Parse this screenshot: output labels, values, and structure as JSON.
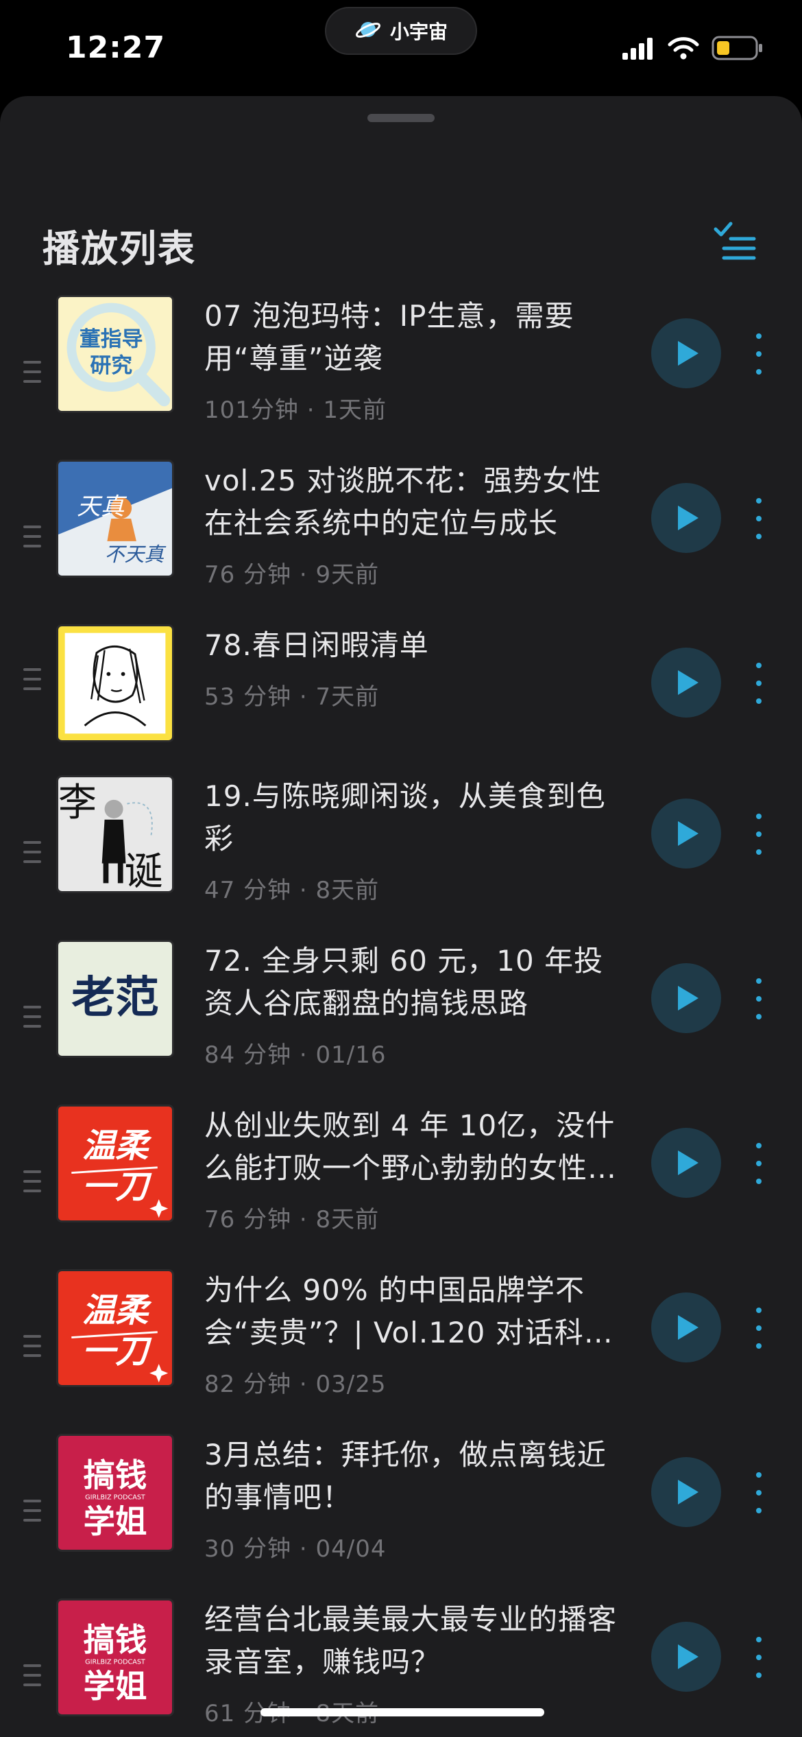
{
  "status_bar": {
    "time": "12:27",
    "island_label": "小宇宙",
    "icons": [
      "signal-icon",
      "wifi-icon",
      "battery-icon"
    ],
    "battery_color": "#f7c624"
  },
  "sheet": {
    "title": "播放列表",
    "accent": "#2fa9d9"
  },
  "episodes": [
    {
      "title": "07 泡泡玛特：IP生意，需要用“尊重”逆袭",
      "meta": "101分钟 · 1天前",
      "cover_text": "董指导研究"
    },
    {
      "title": "vol.25 对谈脱不花：强势女性在社会系统中的定位与成长",
      "meta": "76 分钟 · 9天前",
      "cover_text": "天真 不天真"
    },
    {
      "title": "78.春日闲暇清单",
      "meta": "53 分钟 · 7天前",
      "cover_text": ""
    },
    {
      "title": "19.与陈晓卿闲谈，从美食到色彩",
      "meta": "47 分钟 · 8天前",
      "cover_text": "李诞"
    },
    {
      "title": "72. 全身只剩 60 元，10 年投资人谷底翻盘的搞钱思路",
      "meta": "84 分钟 · 01/16",
      "cover_text": "老范"
    },
    {
      "title": "从创业失败到 4 年 10亿，没什么能打败一个野心勃勃的女性…",
      "meta": "76 分钟 · 8天前",
      "cover_text": "温柔一刀"
    },
    {
      "title": "为什么 90% 的中国品牌学不会“卖贵”？| Vol.120 对话科特…",
      "meta": "82 分钟 · 03/25",
      "cover_text": "温柔一刀"
    },
    {
      "title": "3月总结：拜托你，做点离钱近的事情吧！",
      "meta": "30 分钟 · 04/04",
      "cover_text": "搞钱学姐"
    },
    {
      "title": "经营台北最美最大最专业的播客录音室，赚钱吗？",
      "meta": "61 分钟 · 8天前",
      "cover_text": "搞钱学姐"
    }
  ]
}
